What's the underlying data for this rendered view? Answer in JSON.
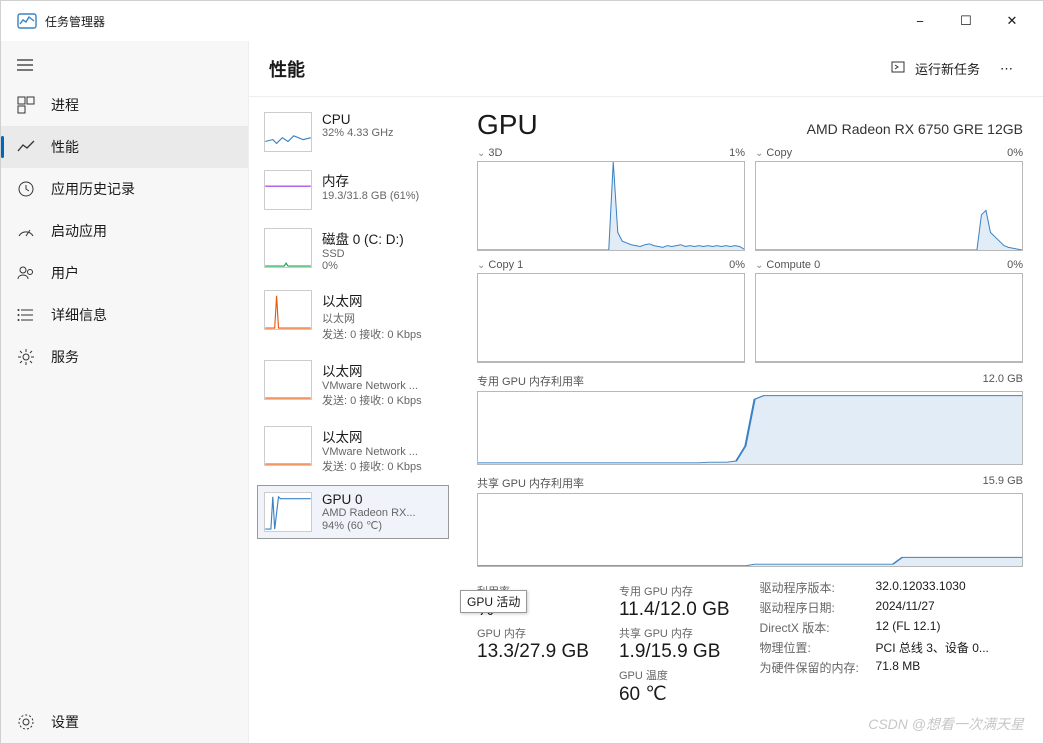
{
  "window": {
    "title": "任务管理器"
  },
  "titlebar_controls": {
    "min": "−",
    "max": "☐",
    "close": "✕"
  },
  "sidebar": {
    "items": [
      {
        "label": "进程"
      },
      {
        "label": "性能"
      },
      {
        "label": "应用历史记录"
      },
      {
        "label": "启动应用"
      },
      {
        "label": "用户"
      },
      {
        "label": "详细信息"
      },
      {
        "label": "服务"
      }
    ],
    "settings": "设置"
  },
  "header": {
    "title": "性能",
    "run_new_task": "运行新任务"
  },
  "perf_list": [
    {
      "name": "CPU",
      "sub": "32% 4.33 GHz",
      "color": "#3b82c4"
    },
    {
      "name": "内存",
      "sub": "19.3/31.8 GB (61%)",
      "color": "#9333ea"
    },
    {
      "name": "磁盘 0 (C: D:)",
      "sub": "SSD",
      "sub2": "0%",
      "color": "#16a34a"
    },
    {
      "name": "以太网",
      "sub": "以太网",
      "sub2": "发送: 0 接收: 0 Kbps",
      "color": "#ea580c"
    },
    {
      "name": "以太网",
      "sub": "VMware Network ...",
      "sub2": "发送: 0 接收: 0 Kbps",
      "color": "#ea580c"
    },
    {
      "name": "以太网",
      "sub": "VMware Network ...",
      "sub2": "发送: 0 接收: 0 Kbps",
      "color": "#ea580c"
    },
    {
      "name": "GPU 0",
      "sub": "AMD Radeon RX...",
      "sub2": "94% (60 ℃)",
      "color": "#3b82c4"
    }
  ],
  "detail": {
    "title": "GPU",
    "subtitle": "AMD Radeon RX 6750 GRE 12GB",
    "charts": [
      {
        "label": "3D",
        "pct": "1%"
      },
      {
        "label": "Copy",
        "pct": "0%"
      },
      {
        "label": "Copy 1",
        "pct": "0%"
      },
      {
        "label": "Compute 0",
        "pct": "0%"
      }
    ],
    "mem_charts": [
      {
        "label": "专用 GPU 内存利用率",
        "max": "12.0 GB"
      },
      {
        "label": "共享 GPU 内存利用率",
        "max": "15.9 GB"
      }
    ],
    "stats_left": [
      {
        "label": "利用率",
        "value": "%"
      },
      {
        "label": "GPU 内存",
        "value": "13.3/27.9 GB"
      }
    ],
    "stats_mid": [
      {
        "label": "专用 GPU 内存",
        "value": "11.4/12.0 GB"
      },
      {
        "label": "共享 GPU 内存",
        "value": "1.9/15.9 GB"
      },
      {
        "label": "GPU 温度",
        "value": "60 ℃"
      }
    ],
    "stats_right": [
      {
        "k": "驱动程序版本:",
        "v": "32.0.12033.1030"
      },
      {
        "k": "驱动程序日期:",
        "v": "2024/11/27"
      },
      {
        "k": "DirectX 版本:",
        "v": "12 (FL 12.1)"
      },
      {
        "k": "物理位置:",
        "v": "PCI 总线 3、设备 0..."
      },
      {
        "k": "为硬件保留的内存:",
        "v": "71.8 MB"
      }
    ]
  },
  "tooltip": "GPU 活动",
  "watermark": "CSDN @想看一次满天星",
  "chart_data": {
    "type": "area",
    "title": "GPU 0 — AMD Radeon RX 6750 GRE 12GB",
    "series": [
      {
        "name": "3D",
        "unit": "%",
        "ylim": [
          0,
          100
        ],
        "values": [
          0,
          0,
          0,
          0,
          0,
          0,
          0,
          0,
          0,
          0,
          0,
          0,
          0,
          0,
          0,
          0,
          0,
          0,
          0,
          0,
          0,
          0,
          0,
          0,
          0,
          0,
          0,
          0,
          0,
          0,
          100,
          20,
          10,
          8,
          6,
          5,
          4,
          6,
          7,
          5,
          4,
          3,
          5,
          4,
          5,
          6,
          4,
          5,
          4,
          5,
          4,
          5,
          4,
          5,
          4,
          5,
          4,
          5,
          4,
          1
        ]
      },
      {
        "name": "Copy",
        "unit": "%",
        "ylim": [
          0,
          100
        ],
        "values": [
          0,
          0,
          0,
          0,
          0,
          0,
          0,
          0,
          0,
          0,
          0,
          0,
          0,
          0,
          0,
          0,
          0,
          0,
          0,
          0,
          0,
          0,
          0,
          0,
          0,
          0,
          0,
          0,
          0,
          0,
          0,
          0,
          0,
          0,
          0,
          0,
          0,
          0,
          0,
          0,
          0,
          0,
          0,
          0,
          0,
          0,
          0,
          0,
          0,
          0,
          40,
          45,
          20,
          15,
          10,
          5,
          3,
          2,
          1,
          0
        ]
      },
      {
        "name": "Copy 1",
        "unit": "%",
        "ylim": [
          0,
          100
        ],
        "values": [
          0,
          0,
          0,
          0,
          0,
          0,
          0,
          0,
          0,
          0,
          0,
          0,
          0,
          0,
          0,
          0,
          0,
          0,
          0,
          0,
          0,
          0,
          0,
          0,
          0,
          0,
          0,
          0,
          0,
          0,
          0,
          0,
          0,
          0,
          0,
          0,
          0,
          0,
          0,
          0,
          0,
          0,
          0,
          0,
          0,
          0,
          0,
          0,
          0,
          0,
          0,
          0,
          0,
          0,
          0,
          0,
          0,
          0,
          0,
          0
        ]
      },
      {
        "name": "Compute 0",
        "unit": "%",
        "ylim": [
          0,
          100
        ],
        "values": [
          0,
          0,
          0,
          0,
          0,
          0,
          0,
          0,
          0,
          0,
          0,
          0,
          0,
          0,
          0,
          0,
          0,
          0,
          0,
          0,
          0,
          0,
          0,
          0,
          0,
          0,
          0,
          0,
          0,
          0,
          0,
          0,
          0,
          0,
          0,
          0,
          0,
          0,
          0,
          0,
          0,
          0,
          0,
          0,
          0,
          0,
          0,
          0,
          0,
          0,
          0,
          0,
          0,
          0,
          0,
          0,
          0,
          0,
          0,
          0
        ]
      },
      {
        "name": "专用 GPU 内存利用率",
        "unit": "GB",
        "ylim": [
          0,
          12.0
        ],
        "values": [
          0.2,
          0.2,
          0.2,
          0.2,
          0.2,
          0.2,
          0.2,
          0.2,
          0.2,
          0.2,
          0.2,
          0.2,
          0.2,
          0.2,
          0.2,
          0.2,
          0.2,
          0.2,
          0.2,
          0.2,
          0.2,
          0.2,
          0.2,
          0.2,
          0.2,
          0.3,
          0.3,
          0.3,
          0.5,
          3.0,
          10.8,
          11.4,
          11.4,
          11.4,
          11.4,
          11.4,
          11.4,
          11.4,
          11.4,
          11.4,
          11.4,
          11.4,
          11.4,
          11.4,
          11.4,
          11.4,
          11.4,
          11.4,
          11.4,
          11.4,
          11.4,
          11.4,
          11.4,
          11.4,
          11.4,
          11.4,
          11.4,
          11.4,
          11.4,
          11.4
        ]
      },
      {
        "name": "共享 GPU 内存利用率",
        "unit": "GB",
        "ylim": [
          0,
          15.9
        ],
        "values": [
          0.05,
          0.05,
          0.05,
          0.05,
          0.05,
          0.05,
          0.05,
          0.05,
          0.05,
          0.05,
          0.05,
          0.05,
          0.05,
          0.05,
          0.05,
          0.05,
          0.05,
          0.05,
          0.05,
          0.05,
          0.05,
          0.05,
          0.05,
          0.05,
          0.05,
          0.05,
          0.05,
          0.05,
          0.05,
          0.05,
          0.4,
          0.4,
          0.4,
          0.4,
          0.4,
          0.4,
          0.4,
          0.4,
          0.4,
          0.4,
          0.4,
          0.4,
          0.4,
          0.4,
          0.4,
          0.4,
          1.9,
          1.9,
          1.9,
          1.9,
          1.9,
          1.9,
          1.9,
          1.9,
          1.9,
          1.9,
          1.9,
          1.9,
          1.9,
          1.9
        ]
      }
    ]
  }
}
